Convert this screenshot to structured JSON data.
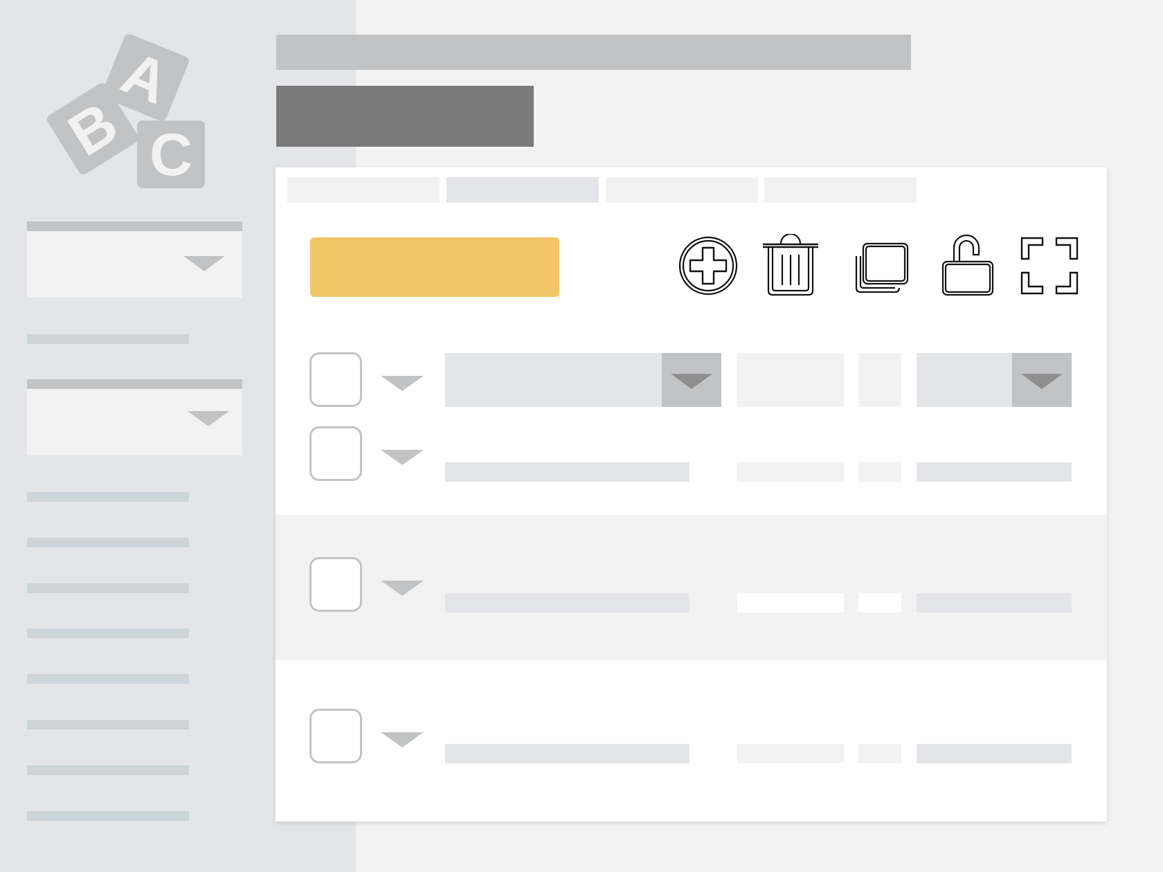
{
  "logo": {
    "icon": "abc-blocks-icon",
    "letters": [
      "A",
      "B",
      "C"
    ]
  },
  "sidebar": {
    "selects": [
      {
        "icon": "caret-down-icon"
      },
      {
        "icon": "caret-down-icon"
      }
    ],
    "items_count_visible": 9
  },
  "toolbar": {
    "primary_button_label": "",
    "icons": [
      "add-circle-icon",
      "trash-icon",
      "duplicate-icon",
      "unlock-icon",
      "fullscreen-icon"
    ]
  },
  "colors": {
    "sidebar_bg": "#e4e5e8",
    "page_bg": "#f2f2f2",
    "panel_bg": "#ffffff",
    "accent": "#f2c666",
    "placeholder": "#c2c3c5",
    "header_dark": "#7a7a7a"
  }
}
